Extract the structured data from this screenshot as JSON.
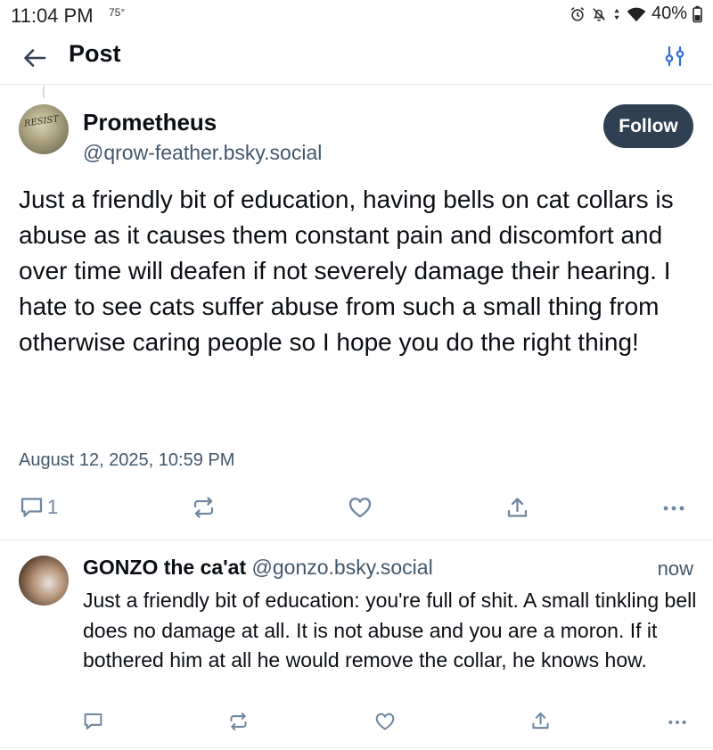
{
  "status_bar": {
    "time": "11:04 PM",
    "temp": "75°",
    "battery": "40%",
    "icons": [
      "alarm-icon",
      "notifications-off-icon",
      "data-arrows-icon",
      "wifi-icon",
      "battery-icon"
    ]
  },
  "header": {
    "title": "Post",
    "back_icon": "arrow-left-icon",
    "filter_icon": "sliders-icon"
  },
  "post": {
    "author_name": "Prometheus",
    "author_handle": "@qrow-feather.bsky.social",
    "avatar_text": "RESIST",
    "follow_label": "Follow",
    "text": "Just a friendly bit of education, having bells on cat collars is abuse as it causes them constant pain and discomfort and over time will deafen if not severely damage their hearing. I hate to see cats suffer abuse from such a small thing from otherwise caring people so I hope you do the right thing!",
    "date": "August 12, 2025, 10:59 PM",
    "reply_count": "1"
  },
  "reply": {
    "author_name": "GONZO the ca'at",
    "author_handle": "@gonzo.bsky.social",
    "time": "now",
    "text": "Just a friendly bit of education: you're full of shit. A small tinkling bell does no damage at all. It is not abuse and you are a moron. If it bothered him at all he would remove the collar, he knows how."
  },
  "colors": {
    "follow_bg": "#2e4052",
    "muted_text": "#42576c",
    "icon": "#6f869f",
    "divider": "#e5e8eb"
  }
}
